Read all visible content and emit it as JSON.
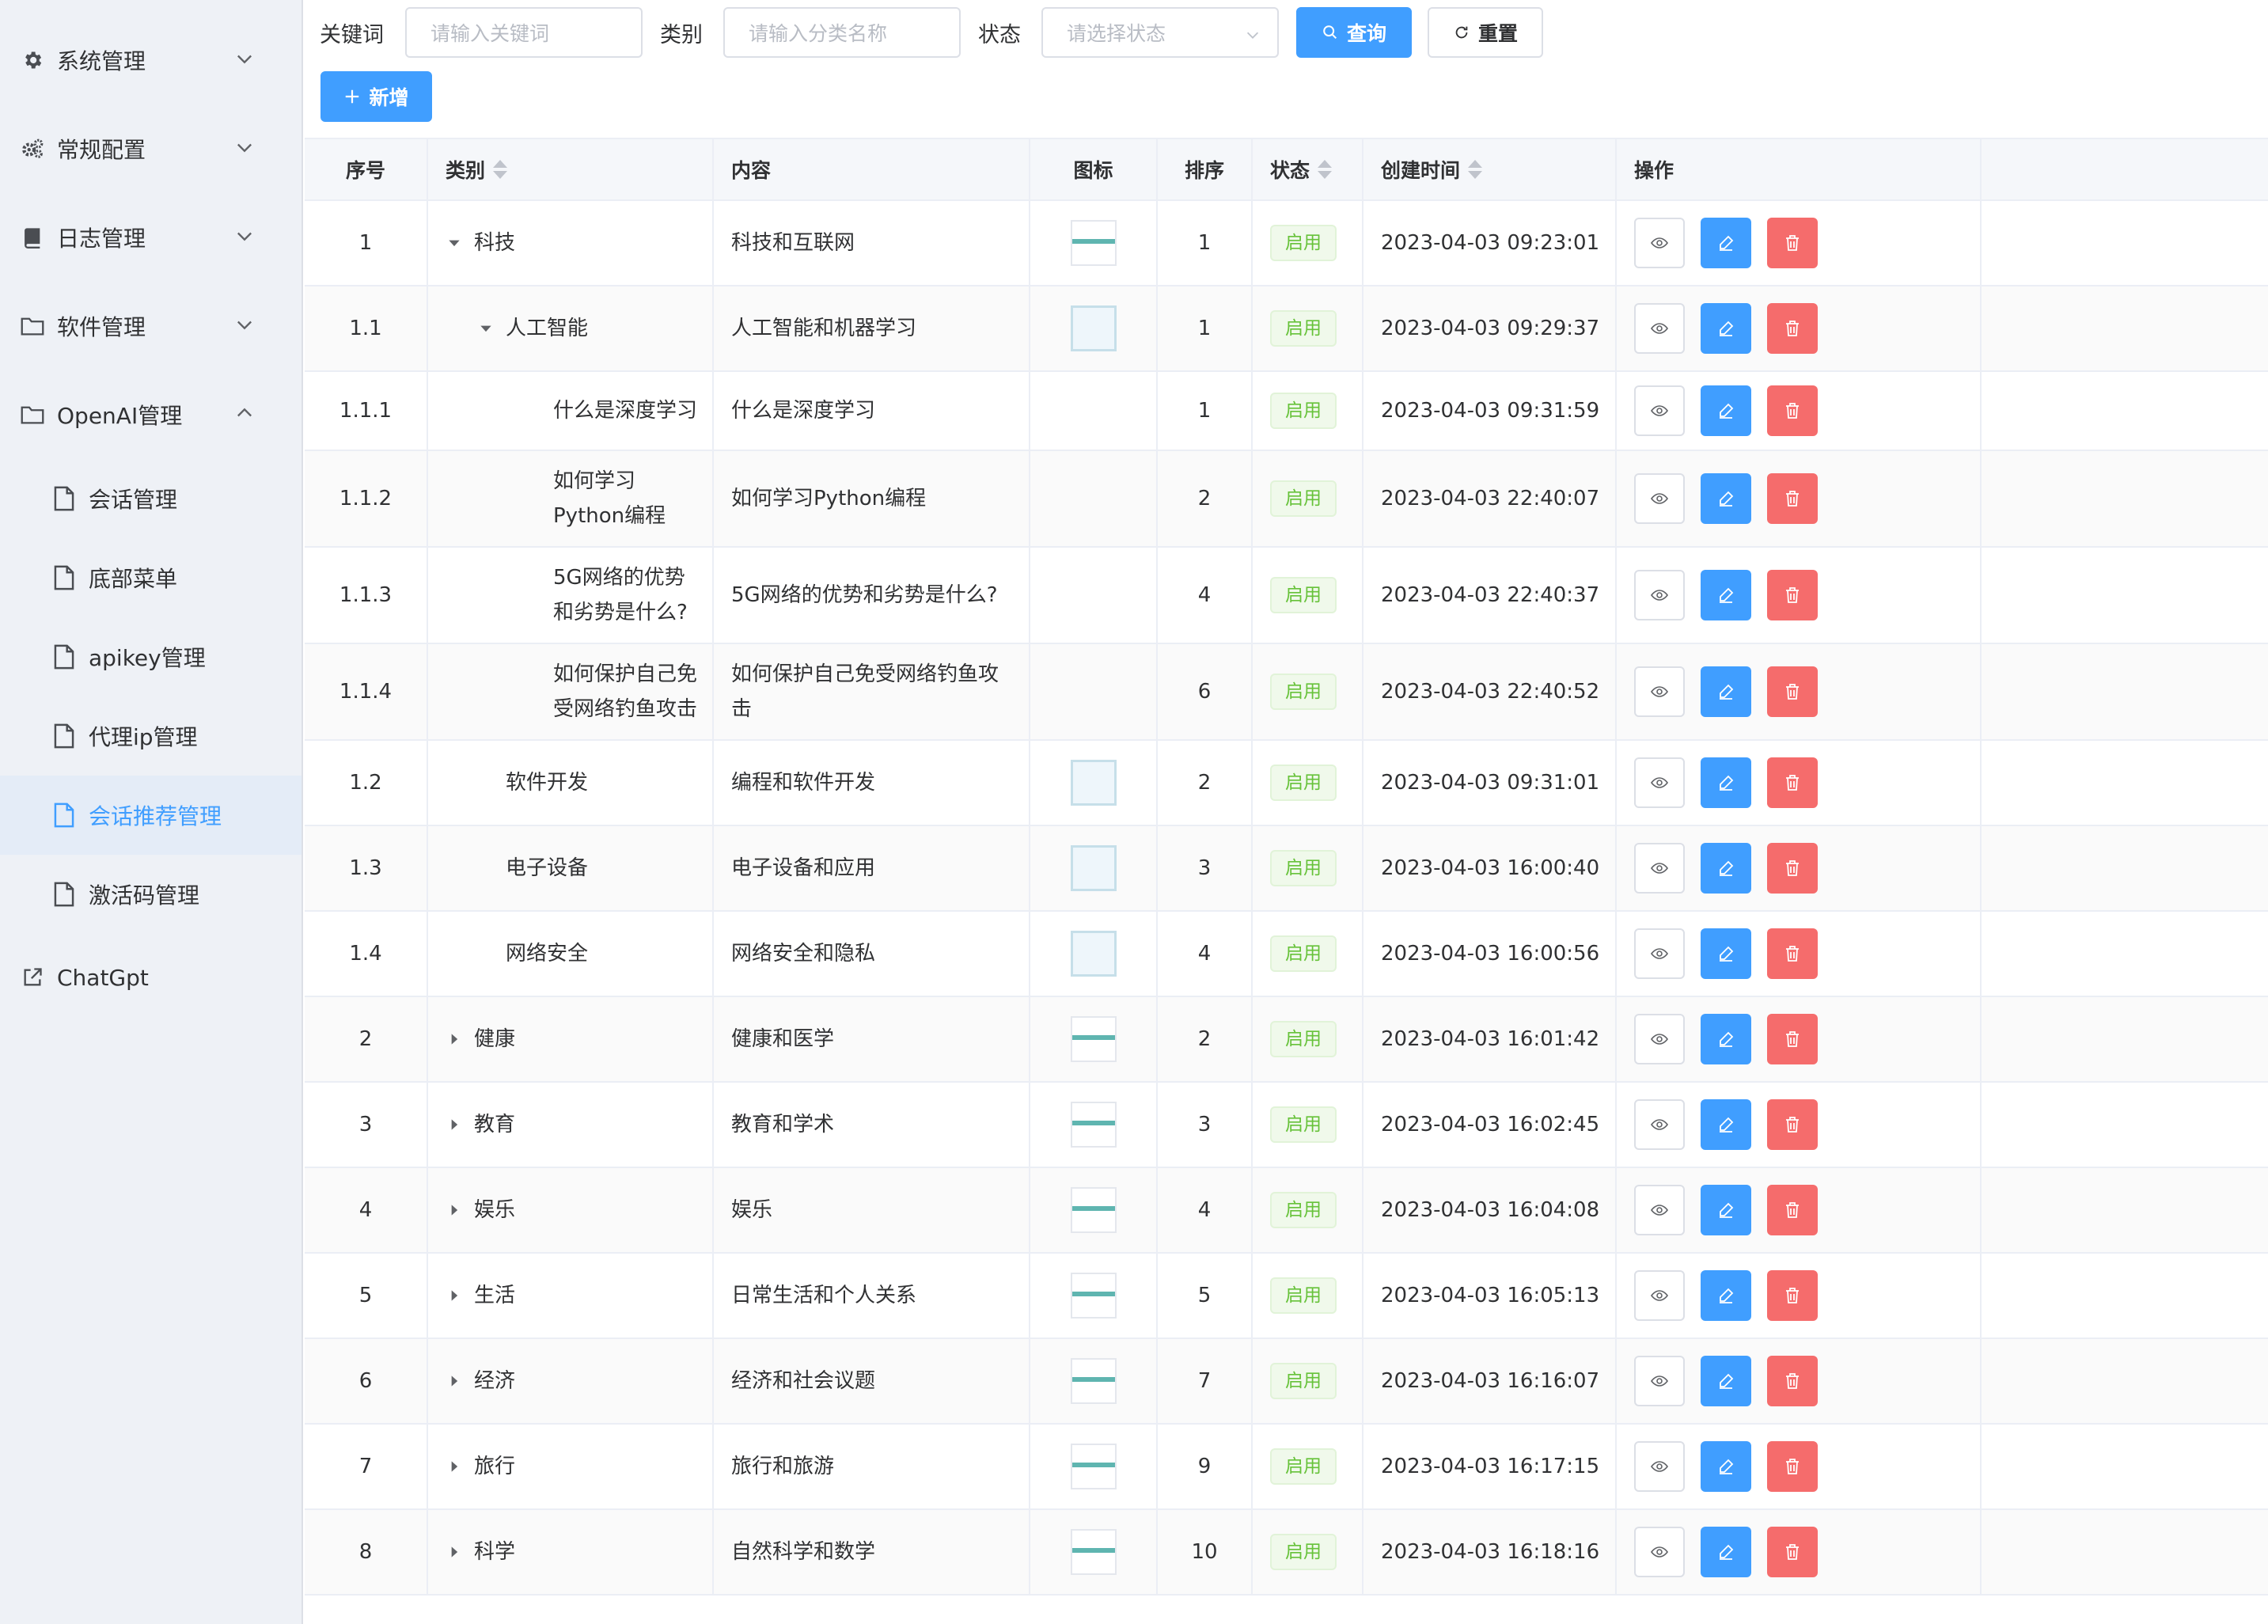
{
  "sidebar": {
    "menus": [
      {
        "label": "系统管理",
        "icon": "gear-icon",
        "expanded": false
      },
      {
        "label": "常规配置",
        "icon": "gears-icon",
        "expanded": false
      },
      {
        "label": "日志管理",
        "icon": "book-icon",
        "expanded": false
      },
      {
        "label": "软件管理",
        "icon": "folder-icon",
        "expanded": false
      },
      {
        "label": "OpenAI管理",
        "icon": "folder-icon",
        "expanded": true
      }
    ],
    "submenus": [
      {
        "label": "会话管理",
        "icon": "document-icon"
      },
      {
        "label": "底部菜单",
        "icon": "document-icon"
      },
      {
        "label": "apikey管理",
        "icon": "document-icon"
      },
      {
        "label": "代理ip管理",
        "icon": "document-icon"
      },
      {
        "label": "会话推荐管理",
        "icon": "document-icon",
        "active": true
      },
      {
        "label": "激活码管理",
        "icon": "document-icon"
      }
    ],
    "external": {
      "label": "ChatGpt",
      "icon": "external-link-icon"
    },
    "active_color": "#409eff"
  },
  "filters": {
    "keyword_label": "关键词",
    "keyword_placeholder": "请输入关键词",
    "category_label": "类别",
    "category_placeholder": "请输入分类名称",
    "status_label": "状态",
    "status_placeholder": "请选择状态",
    "search_button": "查询",
    "reset_button": "重置"
  },
  "toolbar": {
    "add_button": "新增"
  },
  "table": {
    "columns": [
      "序号",
      "类别",
      "内容",
      "图标",
      "排序",
      "状态",
      "创建时间",
      "操作"
    ],
    "status_color": "#67c23a",
    "rows": [
      {
        "seq": "1",
        "category": "科技",
        "content": "科技和互联网",
        "icon": "line",
        "sort": "1",
        "status": "启用",
        "created": "2023-04-03 09:23:01",
        "level": 0,
        "toggle": "expanded"
      },
      {
        "seq": "1.1",
        "category": "人工智能",
        "content": "人工智能和机器学习",
        "icon": "square",
        "sort": "1",
        "status": "启用",
        "created": "2023-04-03 09:29:37",
        "level": 1,
        "toggle": "expanded"
      },
      {
        "seq": "1.1.1",
        "category": "什么是深度学习",
        "content": "什么是深度学习",
        "icon": "none",
        "sort": "1",
        "status": "启用",
        "created": "2023-04-03 09:31:59",
        "level": 2,
        "toggle": "none"
      },
      {
        "seq": "1.1.2",
        "category": "如何学习Python编程",
        "content": "如何学习Python编程",
        "icon": "none",
        "sort": "2",
        "status": "启用",
        "created": "2023-04-03 22:40:07",
        "level": 2,
        "toggle": "none"
      },
      {
        "seq": "1.1.3",
        "category": "5G网络的优势和劣势是什么?",
        "content": "5G网络的优势和劣势是什么?",
        "icon": "none",
        "sort": "4",
        "status": "启用",
        "created": "2023-04-03 22:40:37",
        "level": 2,
        "toggle": "none"
      },
      {
        "seq": "1.1.4",
        "category": "如何保护自己免受网络钓鱼攻击",
        "content": "如何保护自己免受网络钓鱼攻击",
        "icon": "none",
        "sort": "6",
        "status": "启用",
        "created": "2023-04-03 22:40:52",
        "level": 2,
        "toggle": "none"
      },
      {
        "seq": "1.2",
        "category": "软件开发",
        "content": "编程和软件开发",
        "icon": "square",
        "sort": "2",
        "status": "启用",
        "created": "2023-04-03 09:31:01",
        "level": 1,
        "toggle": "none"
      },
      {
        "seq": "1.3",
        "category": "电子设备",
        "content": "电子设备和应用",
        "icon": "square",
        "sort": "3",
        "status": "启用",
        "created": "2023-04-03 16:00:40",
        "level": 1,
        "toggle": "none"
      },
      {
        "seq": "1.4",
        "category": "网络安全",
        "content": "网络安全和隐私",
        "icon": "square",
        "sort": "4",
        "status": "启用",
        "created": "2023-04-03 16:00:56",
        "level": 1,
        "toggle": "none"
      },
      {
        "seq": "2",
        "category": "健康",
        "content": "健康和医学",
        "icon": "line",
        "sort": "2",
        "status": "启用",
        "created": "2023-04-03 16:01:42",
        "level": 0,
        "toggle": "collapsed"
      },
      {
        "seq": "3",
        "category": "教育",
        "content": "教育和学术",
        "icon": "line",
        "sort": "3",
        "status": "启用",
        "created": "2023-04-03 16:02:45",
        "level": 0,
        "toggle": "collapsed"
      },
      {
        "seq": "4",
        "category": "娱乐",
        "content": "娱乐",
        "icon": "line",
        "sort": "4",
        "status": "启用",
        "created": "2023-04-03 16:04:08",
        "level": 0,
        "toggle": "collapsed"
      },
      {
        "seq": "5",
        "category": "生活",
        "content": "日常生活和个人关系",
        "icon": "line",
        "sort": "5",
        "status": "启用",
        "created": "2023-04-03 16:05:13",
        "level": 0,
        "toggle": "collapsed"
      },
      {
        "seq": "6",
        "category": "经济",
        "content": "经济和社会议题",
        "icon": "line",
        "sort": "7",
        "status": "启用",
        "created": "2023-04-03 16:16:07",
        "level": 0,
        "toggle": "collapsed"
      },
      {
        "seq": "7",
        "category": "旅行",
        "content": "旅行和旅游",
        "icon": "line",
        "sort": "9",
        "status": "启用",
        "created": "2023-04-03 16:17:15",
        "level": 0,
        "toggle": "collapsed"
      },
      {
        "seq": "8",
        "category": "科学",
        "content": "自然科学和数学",
        "icon": "line",
        "sort": "10",
        "status": "启用",
        "created": "2023-04-03 16:18:16",
        "level": 0,
        "toggle": "collapsed"
      }
    ]
  }
}
